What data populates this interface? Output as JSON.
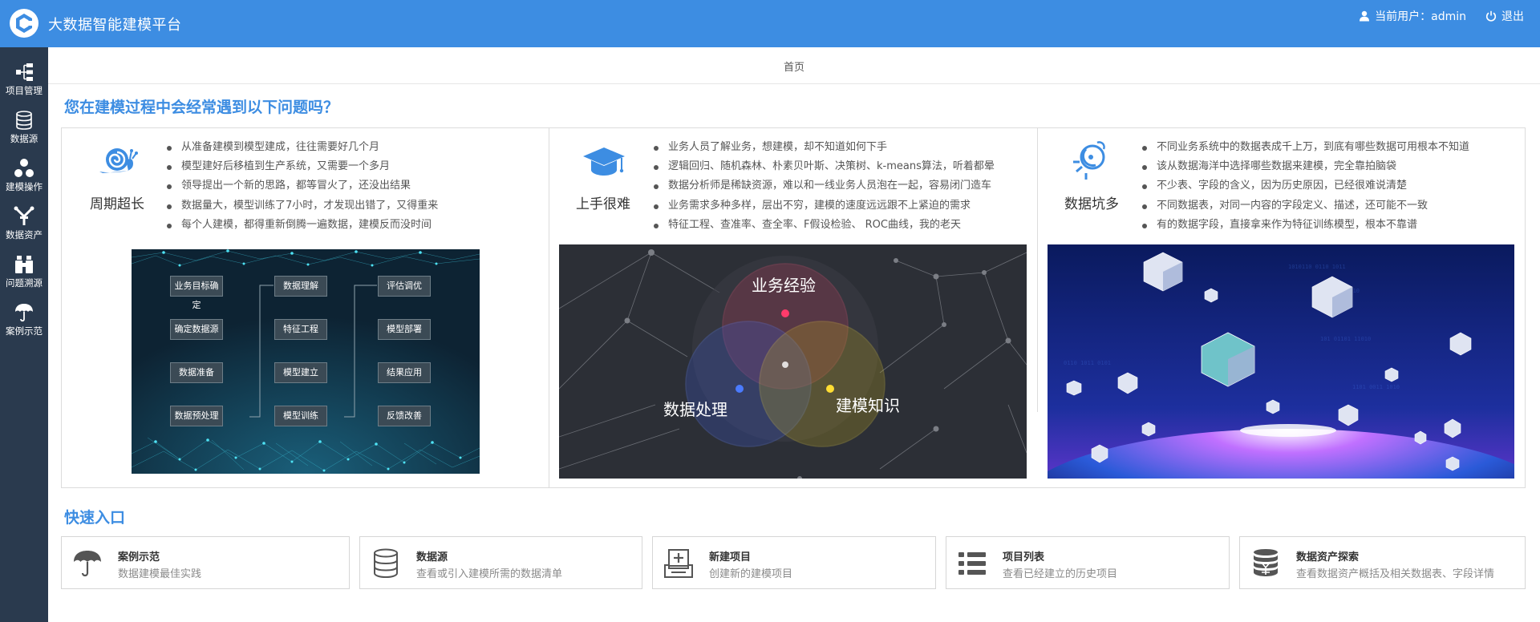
{
  "header": {
    "app_title": "大数据智能建模平台",
    "current_user": "当前用户：admin",
    "logout_label": "退出",
    "brand_color": "#3d8de2"
  },
  "sidebar": {
    "bg_color": "#2a3a4e",
    "items": [
      {
        "label": "项目管理",
        "icon": "project-tree-icon"
      },
      {
        "label": "数据源",
        "icon": "database-icon"
      },
      {
        "label": "建模操作",
        "icon": "modeling-nodes-icon"
      },
      {
        "label": "数据资产",
        "icon": "data-asset-icon"
      },
      {
        "label": "问题溯源",
        "icon": "binoculars-icon"
      },
      {
        "label": "案例示范",
        "icon": "umbrella-icon"
      }
    ]
  },
  "breadcrumb": "首页",
  "problems_section": {
    "title": "您在建模过程中会经常遇到以下问题吗？",
    "columns": [
      {
        "name": "周期超长",
        "icon": "snail-icon",
        "bullets": [
          "从准备建模到模型建成，往往需要好几个月",
          "模型建好后移植到生产系统，又需要一个多月",
          "领导提出一个新的思路，都等冒火了，还没出结果",
          "数据量大，模型训练了7小时，才发现出错了，又得重来",
          "每个人建模，都得重新倒腾一遍数据，建模反而没时间"
        ],
        "flow": {
          "col1": [
            "业务目标确定",
            "确定数据源",
            "数据准备",
            "数据预处理"
          ],
          "col2": [
            "数据理解",
            "特征工程",
            "模型建立",
            "模型训练"
          ],
          "col3": [
            "评估调优",
            "模型部署",
            "结果应用",
            "反馈改善"
          ]
        }
      },
      {
        "name": "上手很难",
        "icon": "graduation-cap-icon",
        "bullets": [
          "业务人员了解业务，想建模，却不知道如何下手",
          "逻辑回归、随机森林、朴素贝叶斯、决策树、k-means算法，听着都晕",
          "数据分析师是稀缺资源，难以和一线业务人员泡在一起，容易闭门造车",
          "业务需求多种多样，层出不穷，建模的速度远远跟不上紧迫的需求",
          "特征工程、查准率、查全率、F假设检验、 ROC曲线，我的老天"
        ],
        "venn": [
          "业务经验",
          "数据处理",
          "建模知识"
        ]
      },
      {
        "name": "数据坑多",
        "icon": "satellite-dish-icon",
        "bullets": [
          "不同业务系统中的数据表成千上万，到底有哪些数据可用根本不知道",
          "该从数据海洋中选择哪些数据来建模，完全靠拍脑袋",
          "不少表、字段的含义，因为历史原因，已经很难说清楚",
          "不同数据表，对同一内容的字段定义、描述，还可能不一致",
          "有的数据字段，直接拿来作为特征训练模型，根本不靠谱"
        ]
      }
    ]
  },
  "quick_entry": {
    "title": "快速入口",
    "cards": [
      {
        "title": "案例示范",
        "desc": "数据建模最佳实践",
        "icon": "umbrella-icon"
      },
      {
        "title": "数据源",
        "desc": "查看或引入建模所需的数据清单",
        "icon": "database-icon"
      },
      {
        "title": "新建项目",
        "desc": "创建新的建模项目",
        "icon": "new-project-icon"
      },
      {
        "title": "项目列表",
        "desc": "查看已经建立的历史项目",
        "icon": "list-icon"
      },
      {
        "title": "数据资产探索",
        "desc": "查看数据资产概括及相关数据表、字段详情",
        "icon": "yuan-coins-icon"
      }
    ]
  }
}
